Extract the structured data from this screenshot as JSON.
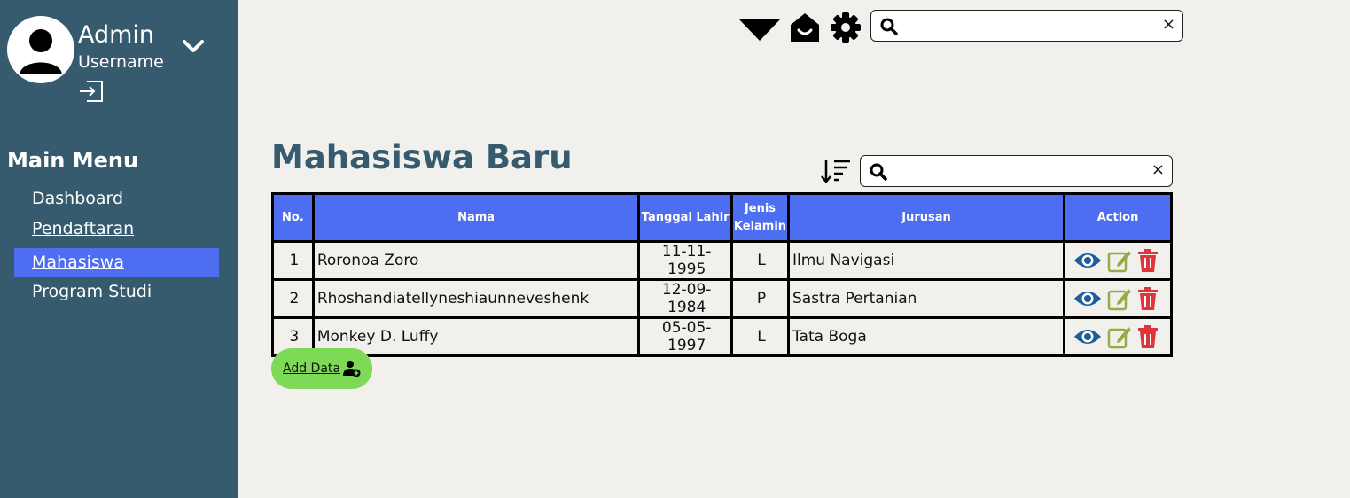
{
  "user": {
    "name": "Admin",
    "role": "Username"
  },
  "menu": {
    "title": "Main Menu",
    "items": [
      {
        "label": "Dashboard"
      },
      {
        "label": "Pendaftaran"
      },
      {
        "label": "Mahasiswa",
        "active": true
      },
      {
        "label": "Program Studi"
      }
    ]
  },
  "topbar": {
    "search_placeholder": "",
    "clear_label": "×"
  },
  "page": {
    "title": "Mahasiswa Baru"
  },
  "table_search": {
    "placeholder": "",
    "clear_label": "×"
  },
  "table": {
    "headers": {
      "no": "No.",
      "nama": "Nama",
      "tanggal": "Tanggal Lahir",
      "jenis_line1": "Jenis",
      "jenis_line2": "Kelamin",
      "jurusan": "Jurusan",
      "action": "Action"
    },
    "rows": [
      {
        "no": "1",
        "nama": "Roronoa Zoro",
        "tanggal": "11-11-1995",
        "jk": "L",
        "jurusan": "Ilmu Navigasi"
      },
      {
        "no": "2",
        "nama": "Rhoshandiatellyneshiaunneveshenk",
        "tanggal": "12-09-1984",
        "jk": "P",
        "jurusan": "Sastra Pertanian"
      },
      {
        "no": "3",
        "nama": "Monkey D. Luffy",
        "tanggal": "05-05-1997",
        "jk": "L",
        "jurusan": "Tata Boga"
      }
    ]
  },
  "add_button": {
    "label": "Add Data"
  },
  "colors": {
    "sidebar": "#365b6e",
    "accent": "#4e6ef2",
    "view_icon": "#1a5e9a",
    "edit_icon": "#9aa845",
    "delete_icon": "#e0343c",
    "add_button": "#7ed957"
  },
  "icons": {
    "avatar": "user-avatar-icon",
    "dropdown": "chevron-down-icon",
    "logout": "logout-icon",
    "top_dropdown": "triangle-down-icon",
    "home": "home-icon",
    "settings": "gear-icon",
    "search": "search-icon",
    "sort": "sort-icon",
    "view": "eye-icon",
    "edit": "edit-icon",
    "delete": "trash-icon",
    "add_user": "add-user-icon"
  }
}
